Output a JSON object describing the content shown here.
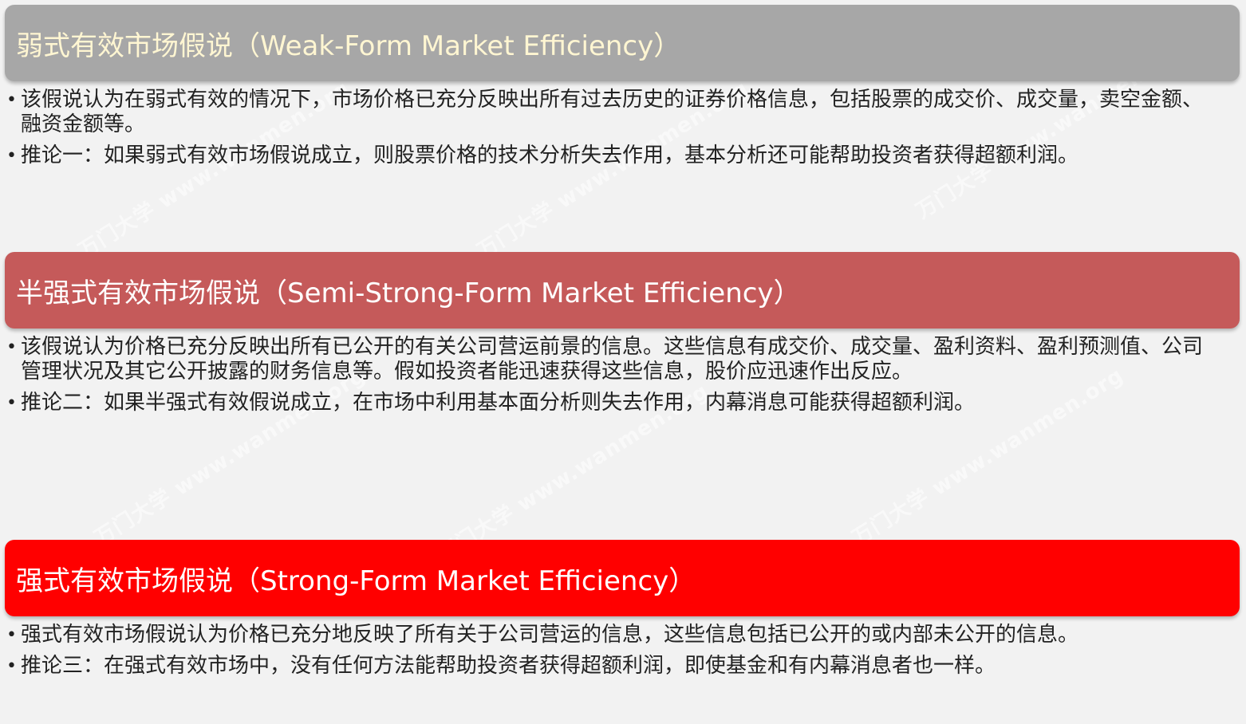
{
  "weak": {
    "title": "弱式有效市场假说（Weak-Form Market Efficiency）",
    "bullets": [
      "该假说认为在弱式有效的情况下，市场价格已充分反映出所有过去历史的证券价格信息，包括股票的成交价、成交量，卖空金额、融资金额等。",
      "推论一：如果弱式有效市场假说成立，则股票价格的技术分析失去作用，基本分析还可能帮助投资者获得超额利润。"
    ]
  },
  "semi": {
    "title": "半强式有效市场假说（Semi-Strong-Form Market Efficiency）",
    "bullets": [
      "该假说认为价格已充分反映出所有已公开的有关公司营运前景的信息。这些信息有成交价、成交量、盈利资料、盈利预测值、公司管理状况及其它公开披露的财务信息等。假如投资者能迅速获得这些信息，股价应迅速作出反应。",
      "推论二：如果半强式有效假说成立，在市场中利用基本面分析则失去作用，内幕消息可能获得超额利润。"
    ]
  },
  "strong": {
    "title": "强式有效市场假说（Strong-Form Market Efficiency）",
    "bullets": [
      "强式有效市场假说认为价格已充分地反映了所有关于公司营运的信息，这些信息包括已公开的或内部未公开的信息。",
      "推论三：在强式有效市场中，没有任何方法能帮助投资者获得超额利润，即使基金和有内幕消息者也一样。"
    ]
  },
  "bullet_glyph": "•",
  "watermark": "万门大学 www.wanmen.org"
}
